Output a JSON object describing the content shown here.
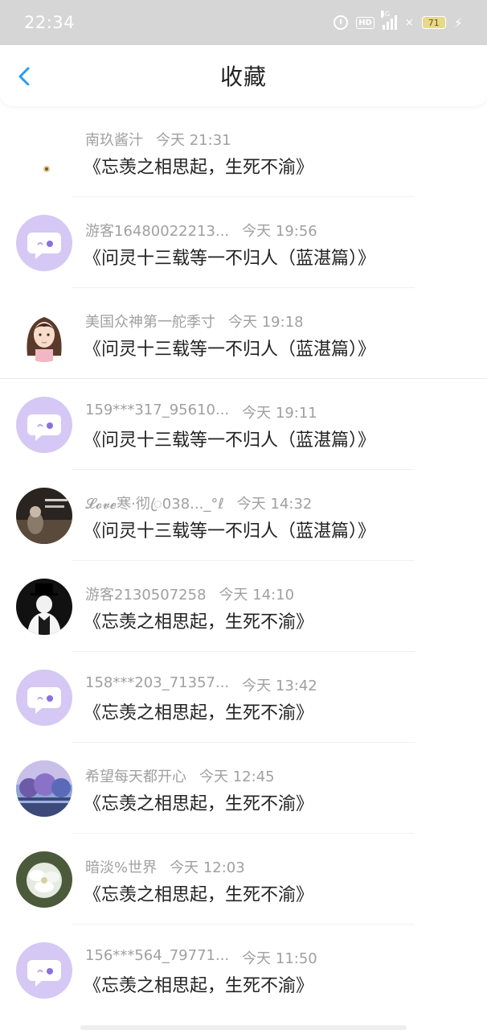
{
  "status_bar": {
    "time": "22:34",
    "hd_label": "HD",
    "network_label": "4G",
    "x_mark": "×",
    "battery": "71"
  },
  "header": {
    "title": "收藏"
  },
  "items": [
    {
      "user": "南玖酱汁",
      "time": "今天 21:31",
      "text": "《忘羡之相思起，生死不渝》"
    },
    {
      "user": "游客16480022213...",
      "time": "今天 19:56",
      "text": "《问灵十三载等一不归人（蓝湛篇）》"
    },
    {
      "user": "美国众神第一舵季寸",
      "time": "今天 19:18",
      "text": "《问灵十三载等一不归人（蓝湛篇）》"
    },
    {
      "user": "159***317_95610...",
      "time": "今天 19:11",
      "text": "《问灵十三载等一不归人（蓝湛篇）》"
    },
    {
      "user": "𝓛𝓸𝓿𝓮寒·彻ꦿ038..._°ℓ",
      "time": "今天 14:32",
      "text": "《问灵十三载等一不归人（蓝湛篇）》"
    },
    {
      "user": "游客2130507258",
      "time": "今天 14:10",
      "text": "《忘羡之相思起，生死不渝》"
    },
    {
      "user": "158***203_71357...",
      "time": "今天 13:42",
      "text": "《忘羡之相思起，生死不渝》"
    },
    {
      "user": "希望每天都开心",
      "time": "今天 12:45",
      "text": "《忘羡之相思起，生死不渝》"
    },
    {
      "user": "暗淡%世界",
      "time": "今天 12:03",
      "text": "《忘羡之相思起，生死不渝》"
    },
    {
      "user": "156***564_79771...",
      "time": "今天 11:50",
      "text": "《忘羡之相思起，生死不渝》"
    }
  ],
  "colors": {
    "accent": "#2a9cf0",
    "avatar_default_bg": "#d5c8f4"
  }
}
